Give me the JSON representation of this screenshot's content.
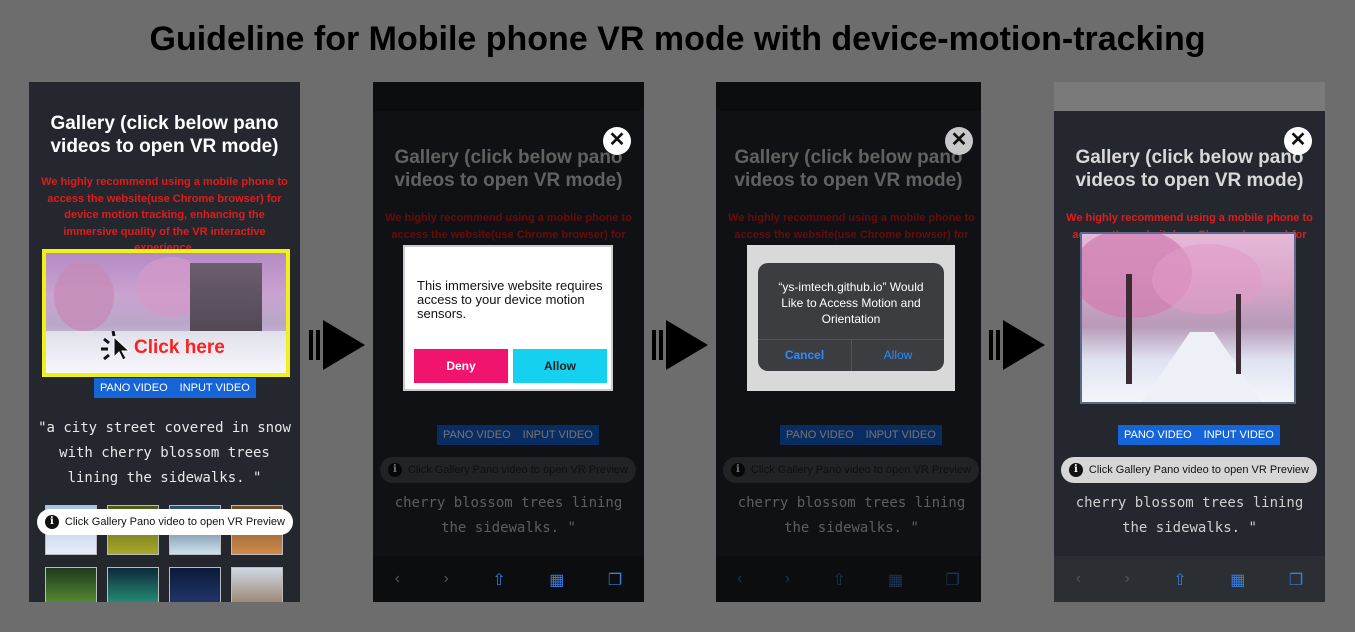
{
  "title": "Guideline for Mobile phone VR mode with device-motion-tracking",
  "gallery_title": "Gallery (click below pano videos to open VR mode)",
  "recommendation": "We highly recommend using a mobile phone to access the website(use Chrome browser) for device motion tracking, enhancing the immersive quality of the VR interactive experience.",
  "click_here": "Click here",
  "tabs": [
    "PANO VIDEO",
    "INPUT VIDEO"
  ],
  "prompt": "\"a city street covered in snow with cherry blossom trees lining the sidewalks. \"",
  "prompt_partial": "cherry blossom trees lining the sidewalks. \"",
  "preview_tip": "Click Gallery Pano video to open VR Preview",
  "permission_dialog": {
    "text": "This immersive website requires access to your device motion sensors.",
    "deny": "Deny",
    "allow": "Allow"
  },
  "ios_alert": {
    "text": "“ys-imtech.github.io” Would Like to Access Motion and Orientation",
    "cancel": "Cancel",
    "allow": "Allow"
  },
  "close_symbol": "✕",
  "colors": {
    "background": "#6d6d6d",
    "accent_blue": "#1565d8",
    "recommend_red": "#e21b1b",
    "highlight_yellow": "#f0f01a",
    "deny_pink": "#f0146e",
    "allow_cyan": "#16d0f0"
  },
  "icons": [
    "arrow-right-icon",
    "info-icon",
    "close-icon",
    "cursor-click-icon",
    "back-icon",
    "forward-icon",
    "share-icon",
    "bookmarks-icon",
    "tabs-icon"
  ]
}
